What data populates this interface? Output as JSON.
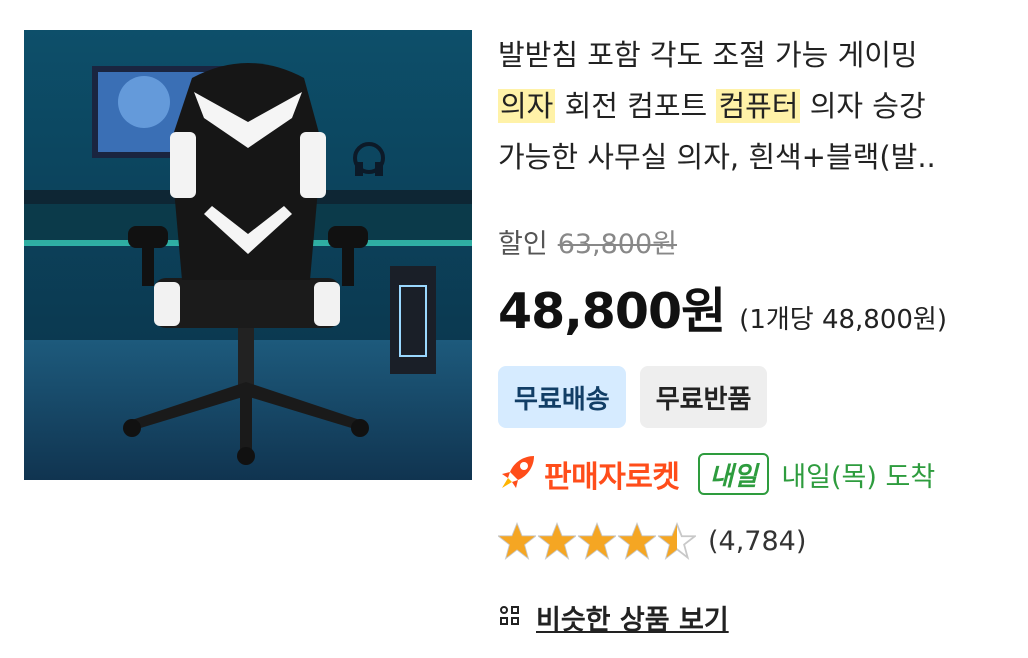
{
  "product": {
    "image_alt": "black-white gaming chair",
    "title_line1": "발받침 포함 각도 조절 가능 게이밍",
    "title_line2": {
      "hl1": "의자",
      "t1": " 회전 컴포트 ",
      "hl2": "컴퓨터",
      "t2": " 의자 승강"
    },
    "title_line3": "가능한 사무실 의자, 흰색+블랙(발.."
  },
  "pricing": {
    "discount_label": "할인",
    "original_price": "63,800원",
    "price": "48,800원",
    "unit_price": "(1개당 48,800원)"
  },
  "badges": {
    "free_shipping": "무료배송",
    "free_return": "무료반품"
  },
  "delivery": {
    "rocket_label": "판매자로켓",
    "tomorrow_badge": "내일",
    "arrival_text": "내일(목) 도착"
  },
  "rating": {
    "stars": 4.5,
    "review_count": "(4,784)"
  },
  "similar": {
    "label": "비슷한 상품 보기"
  },
  "colors": {
    "rocket": "#ff4d1a",
    "green": "#2e9c3e",
    "star": "#f5a623",
    "highlight": "#fff2a8",
    "ship_badge": "#d6ebff"
  }
}
